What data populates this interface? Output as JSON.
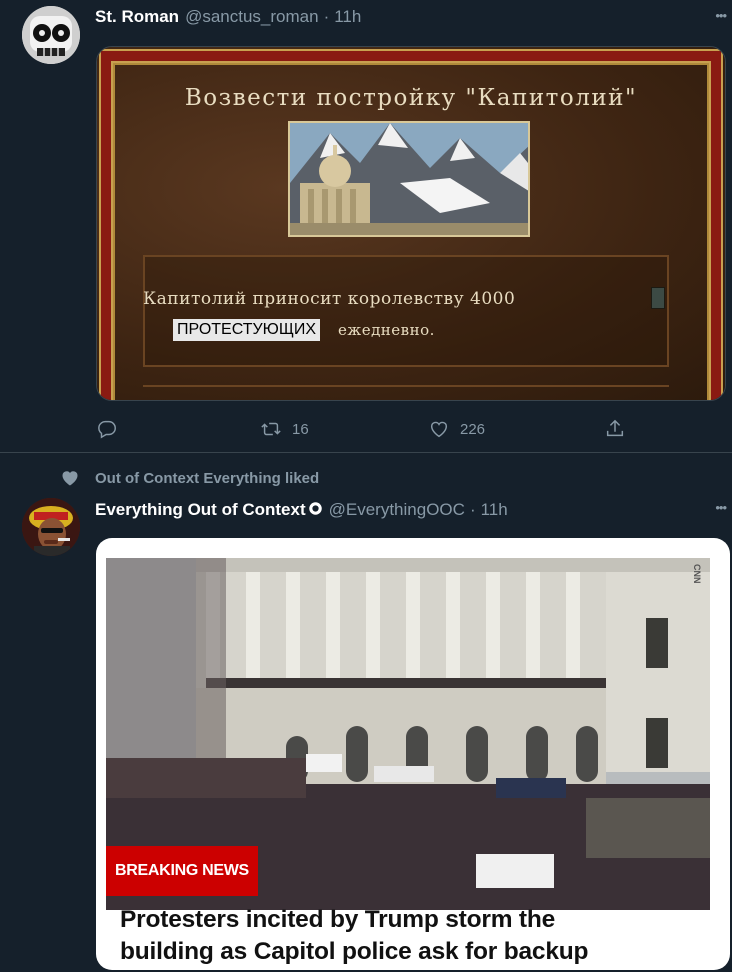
{
  "tweet1": {
    "display_name": "St. Roman",
    "handle": "@sanctus_roman",
    "separator": "·",
    "time": "11h",
    "more": "•••",
    "game": {
      "title": "Возвести постройку \"Капитолий\"",
      "description": "Капитолий приносит королевству 4000",
      "highlight": "ПРОТЕСТУЮЩИХ",
      "suffix": "ежедневно."
    },
    "retweets": "16",
    "likes": "226"
  },
  "liked_notice": "Out of Context Everything liked",
  "tweet2": {
    "display_name": "Everything Out of Context",
    "handle": "@EverythingOOC",
    "separator": "·",
    "time": "11h",
    "more": "•••",
    "news": {
      "banner": "BREAKING NEWS",
      "watermark": "CNN",
      "headline_line1": "Protesters incited by Trump storm the",
      "headline_line2": "building as Capitol police ask for backup"
    }
  },
  "icons": [
    "reply-icon",
    "retweet-icon",
    "like-icon",
    "share-icon",
    "heart-icon",
    "verified-icon",
    "more-icon"
  ],
  "colors": {
    "background": "#15202b",
    "secondary_text": "#8899a6",
    "divider": "#38444d",
    "breaking_red": "#cc0000"
  }
}
